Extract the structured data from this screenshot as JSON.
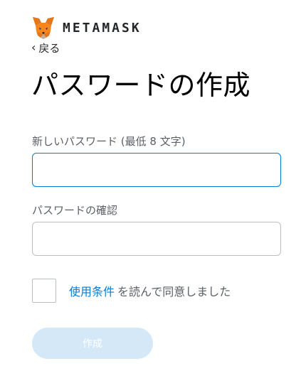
{
  "header": {
    "brand": "METAMASK",
    "logo_icon": "metamask-fox-icon"
  },
  "back": {
    "icon": "chevron-left-icon",
    "label": "戻る"
  },
  "title": "パスワードの作成",
  "new_password": {
    "label": "新しいパスワード (最低 8 文字)",
    "value": "",
    "placeholder": ""
  },
  "confirm_password": {
    "label": "パスワードの確認",
    "value": "",
    "placeholder": ""
  },
  "terms": {
    "checked": false,
    "link_text": "使用条件",
    "suffix": "を読んで同意しました"
  },
  "create_button": {
    "label": "作成",
    "enabled": false
  },
  "colors": {
    "accent": "#037dd6",
    "disabled_button": "#d5e8f8",
    "border": "#bbc0c5",
    "fox_orange": "#e2761b"
  }
}
